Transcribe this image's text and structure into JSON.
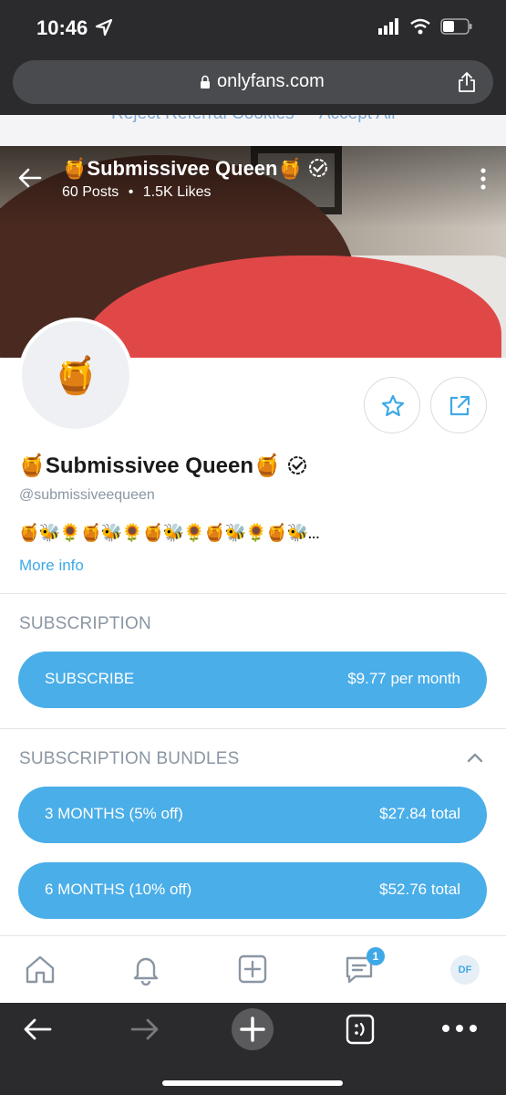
{
  "status_bar": {
    "time": "10:46"
  },
  "browser": {
    "url": "onlyfans.com"
  },
  "cookie_banner": {
    "reject_label": "Reject Referral Cookies",
    "accept_label": "Accept All"
  },
  "header": {
    "title": "🍯Submissivee Queen🍯",
    "posts": "60 Posts",
    "separator": "•",
    "likes": "1.5K Likes"
  },
  "profile": {
    "avatar_emoji": "🍯",
    "name": "🍯Submissivee Queen🍯",
    "handle": "@submissiveequeen",
    "bio": "🍯🐝🌻🍯🐝🌻🍯🐝🌻🍯🐝🌻🍯🐝...",
    "more_info": "More info"
  },
  "subscription": {
    "title": "SUBSCRIPTION",
    "button_label": "SUBSCRIBE",
    "price": "$9.77 per month"
  },
  "bundles": {
    "title": "SUBSCRIPTION BUNDLES",
    "items": [
      {
        "label": "3 MONTHS (5% off)",
        "price": "$27.84 total"
      },
      {
        "label": "6 MONTHS (10% off)",
        "price": "$52.76 total"
      }
    ]
  },
  "app_nav": {
    "messages_badge": "1",
    "avatar_initials": "DF"
  },
  "colors": {
    "accent": "#4aaee8",
    "link": "#3ea9e6",
    "muted": "#8a96a3",
    "chrome": "#2b2b2d"
  }
}
